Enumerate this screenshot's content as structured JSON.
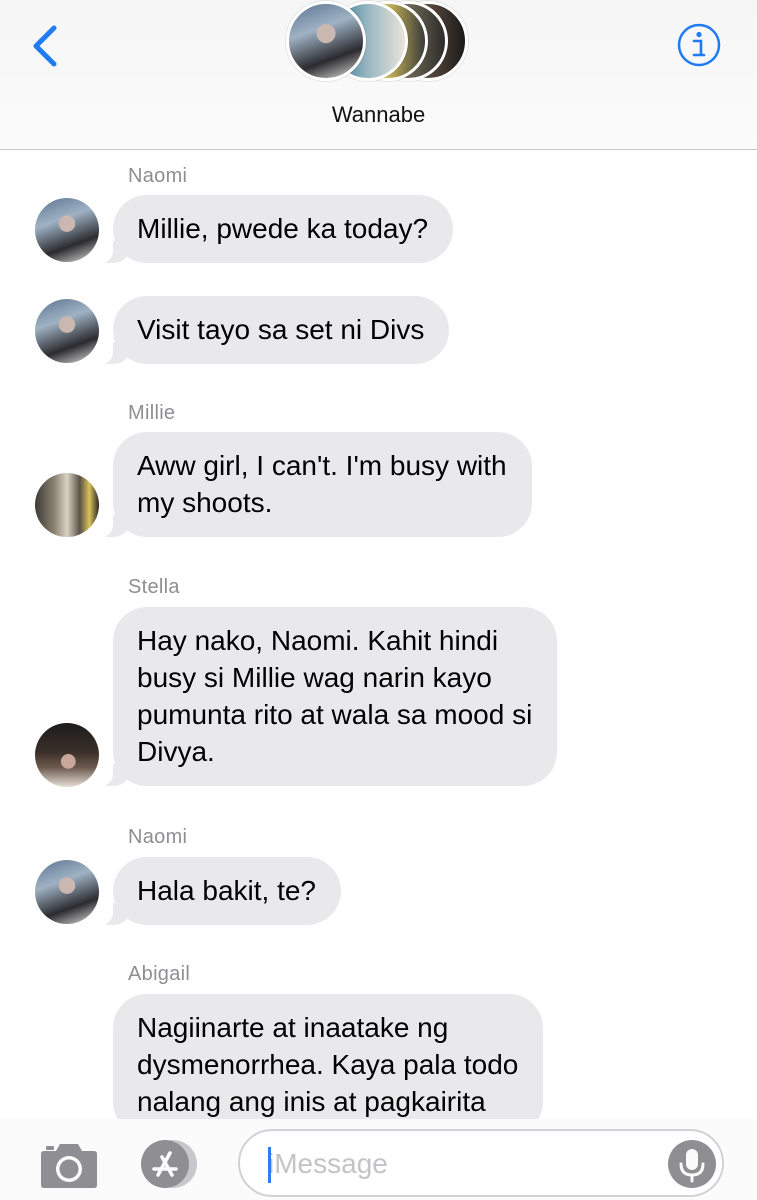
{
  "header": {
    "group_name": "Wannabe",
    "accent_color": "#1f7cf5"
  },
  "messages": [
    {
      "sender": "Naomi",
      "lines": [
        "Millie, pwede ka today?"
      ],
      "avatar": "naomi"
    },
    {
      "sender": "",
      "lines": [
        "Visit tayo sa set ni Divs"
      ],
      "avatar": "naomi"
    },
    {
      "sender": "Millie",
      "lines": [
        "Aww girl, I can't. I'm busy with",
        "my shoots."
      ],
      "avatar": "millie"
    },
    {
      "sender": "Stella",
      "lines": [
        "Hay nako, Naomi. Kahit hindi",
        "busy si Millie wag narin kayo",
        "pumunta rito at wala sa mood si",
        "Divya."
      ],
      "avatar": "stella"
    },
    {
      "sender": "Naomi",
      "lines": [
        "Hala bakit, te?"
      ],
      "avatar": "naomi"
    },
    {
      "sender": "Abigail",
      "lines": [
        "Nagiinarte at inaatake ng",
        "dysmenorrhea. Kaya pala todo",
        "nalang ang inis at pagkairita"
      ],
      "avatar": "abigail"
    }
  ],
  "composer": {
    "placeholder": "iMessage",
    "value": ""
  },
  "icons": {
    "back": "chevron-left-icon",
    "info": "info-icon",
    "camera": "camera-icon",
    "appstore": "app-store-icon",
    "mic": "microphone-icon"
  }
}
